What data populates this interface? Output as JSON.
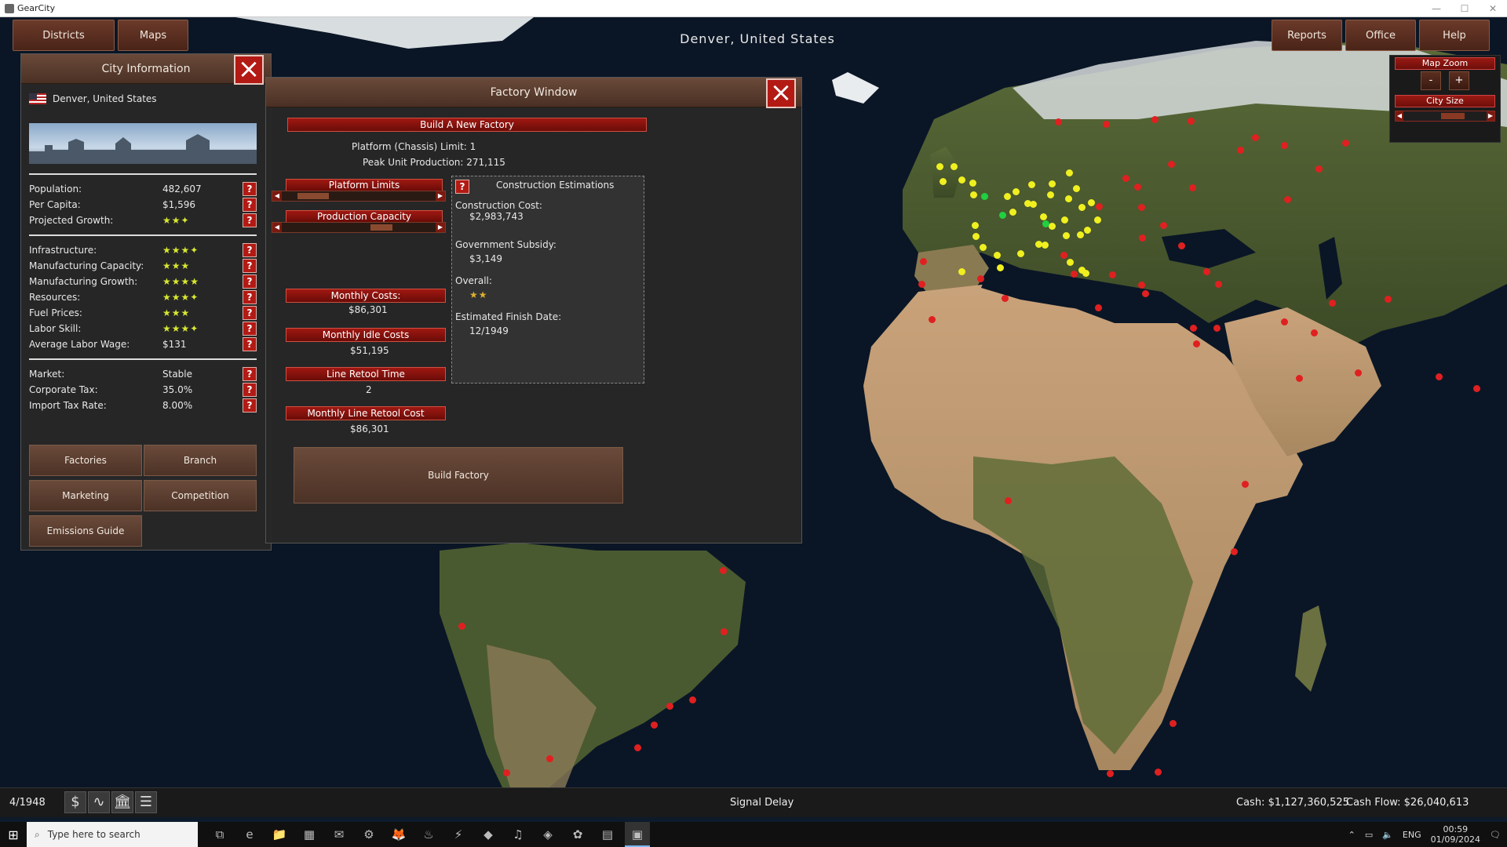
{
  "window": {
    "title": "GearCity",
    "controls": [
      "—",
      "☐",
      "✕"
    ]
  },
  "topbar": {
    "left_buttons": [
      "Districts",
      "Maps"
    ],
    "right_buttons": [
      "Reports",
      "Office",
      "Help"
    ],
    "city_title": "Denver,  United  States"
  },
  "map_zoom": {
    "zoom_label": "Map  Zoom",
    "minus": "-",
    "plus": "+",
    "city_size_label": "City  Size"
  },
  "city_info": {
    "title": "City  Information",
    "location": "Denver,  United  States",
    "stats_group1": [
      {
        "label": "Population:",
        "value": "482,607"
      },
      {
        "label": "Per  Capita:",
        "value": "$1,596"
      },
      {
        "label": "Projected  Growth:",
        "stars": "★★✦"
      }
    ],
    "stats_group2": [
      {
        "label": "Infrastructure:",
        "stars": "★★★✦"
      },
      {
        "label": "Manufacturing  Capacity:",
        "stars": "★★★"
      },
      {
        "label": "Manufacturing  Growth:",
        "stars": "★★★★"
      },
      {
        "label": "Resources:",
        "stars": "★★★✦"
      },
      {
        "label": "Fuel  Prices:",
        "stars": "★★★"
      },
      {
        "label": "Labor  Skill:",
        "stars": "★★★✦"
      },
      {
        "label": "Average  Labor  Wage:",
        "value": "$131"
      }
    ],
    "stats_group3": [
      {
        "label": "Market:",
        "value": "Stable"
      },
      {
        "label": "Corporate  Tax:",
        "value": "35.0%"
      },
      {
        "label": "Import  Tax  Rate:",
        "value": "8.00%"
      }
    ],
    "help_glyph": "?",
    "buttons": [
      "Factories",
      "Branch",
      "Marketing",
      "Competition",
      "Emissions  Guide"
    ]
  },
  "factory_window": {
    "title": "Factory  Window",
    "build_header": "Build  A  New  Factory",
    "platform_limit": "Platform  (Chassis)  Limit: 1",
    "peak_production": "Peak  Unit  Production: 271,115",
    "platform_limits_label": "Platform  Limits",
    "production_capacity_label": "Production  Capacity",
    "monthly_costs_label": "Monthly  Costs:",
    "monthly_costs_value": "$86,301",
    "monthly_idle_label": "Monthly  Idle  Costs",
    "monthly_idle_value": "$51,195",
    "line_retool_time_label": "Line  Retool  Time",
    "line_retool_time_value": "2",
    "monthly_retool_label": "Monthly  Line  Retool  Cost",
    "monthly_retool_value": "$86,301",
    "build_factory_button": "Build  Factory",
    "platform_limits_slider": 0.2,
    "production_capacity_slider": 0.64,
    "estimations": {
      "help_glyph": "?",
      "title": "Construction  Estimations",
      "construction_cost_label": "Construction  Cost:",
      "construction_cost_value": "$2,983,743",
      "government_subsidy_label": "Government  Subsidy:",
      "government_subsidy_value": "$3,149",
      "overall_label": "Overall:",
      "overall_stars": "★★",
      "finish_date_label": "Estimated  Finish  Date:",
      "finish_date_value": "12/1949"
    }
  },
  "statusbar": {
    "date": "4/1948",
    "icons": [
      "$",
      "∿",
      "🏛",
      "☰"
    ],
    "signal": "Signal  Delay",
    "cash": "Cash:  $1,127,360,525",
    "cash_flow": "Cash  Flow:  $26,040,613"
  },
  "taskbar": {
    "start_icon": "⊞",
    "search_icon": "⌕",
    "search_placeholder": "Type here to search",
    "apps": [
      "⧉",
      "e",
      "📁",
      "▦",
      "✉",
      "⚙",
      "🦊",
      "♨",
      "⚡",
      "◆",
      "♫",
      "◈",
      "✿",
      "▤",
      "▣"
    ],
    "lang": "ENG",
    "time": "00:59",
    "date": "01/09/2024"
  },
  "colors": {
    "accent_red": "#b31a14",
    "panel_brown": "#6a4a3a",
    "star_yellow": "#d8e830",
    "city_dot_red": "#e02020",
    "city_dot_yellow": "#f0f020",
    "city_dot_green": "#20d040"
  }
}
